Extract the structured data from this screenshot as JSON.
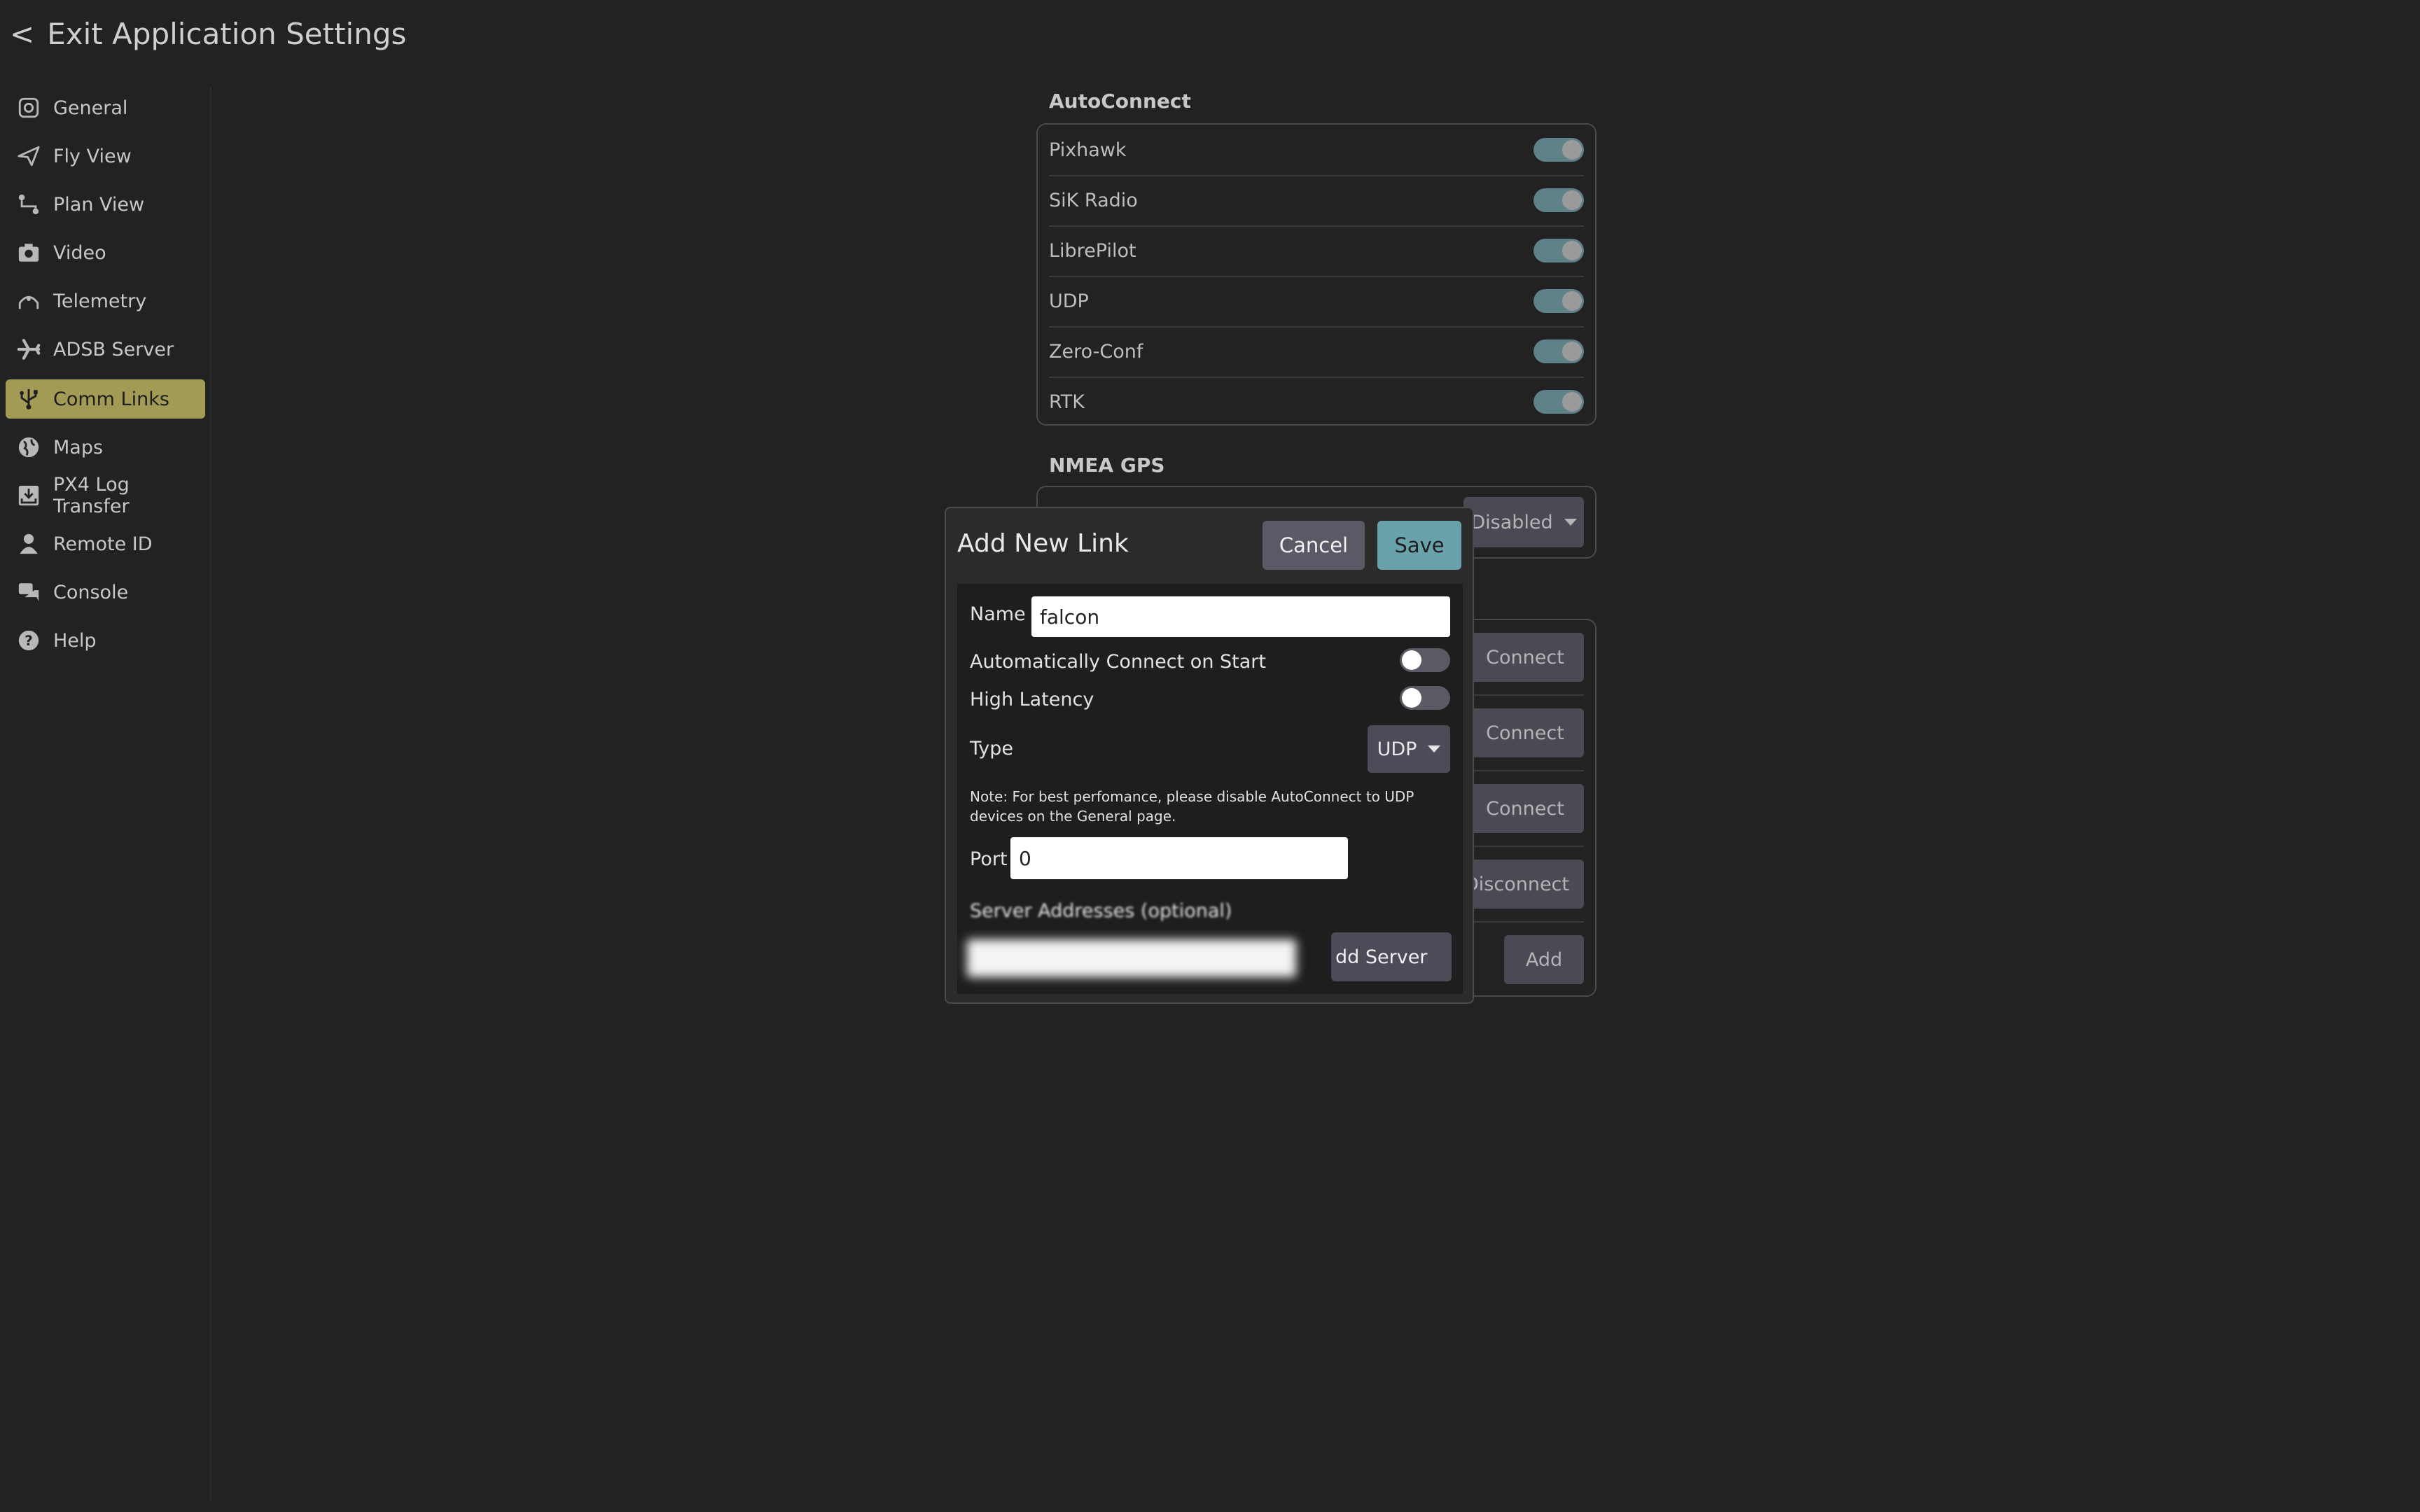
{
  "header": {
    "exit_label": "Exit Application Settings",
    "back_glyph": "<"
  },
  "sidebar": {
    "items": [
      {
        "label": "General",
        "icon": "general-icon"
      },
      {
        "label": "Fly View",
        "icon": "paper-plane-icon"
      },
      {
        "label": "Plan View",
        "icon": "route-icon"
      },
      {
        "label": "Video",
        "icon": "camera-icon"
      },
      {
        "label": "Telemetry",
        "icon": "telemetry-icon"
      },
      {
        "label": "ADSB Server",
        "icon": "airplane-icon"
      },
      {
        "label": "Comm Links",
        "icon": "usb-icon",
        "active": true
      },
      {
        "label": "Maps",
        "icon": "globe-icon"
      },
      {
        "label": "PX4 Log Transfer",
        "icon": "download-icon"
      },
      {
        "label": "Remote ID",
        "icon": "person-icon"
      },
      {
        "label": "Console",
        "icon": "chat-icon"
      },
      {
        "label": "Help",
        "icon": "help-icon"
      }
    ]
  },
  "autoconnect": {
    "title": "AutoConnect",
    "rows": [
      {
        "label": "Pixhawk",
        "on": true
      },
      {
        "label": "SiK Radio",
        "on": true
      },
      {
        "label": "LibrePilot",
        "on": true
      },
      {
        "label": "UDP",
        "on": true
      },
      {
        "label": "Zero-Conf",
        "on": true
      },
      {
        "label": "RTK",
        "on": true
      }
    ]
  },
  "nmea": {
    "title": "NMEA GPS",
    "value": "Disabled"
  },
  "links": {
    "buttons": [
      "Connect",
      "Connect",
      "Connect",
      "Disconnect"
    ],
    "add_label": "Add"
  },
  "dialog": {
    "title": "Add New Link",
    "cancel_label": "Cancel",
    "save_label": "Save",
    "name_label": "Name",
    "name_value": "falcon",
    "auto_connect_label": "Automatically Connect on Start",
    "auto_connect_on": false,
    "high_latency_label": "High Latency",
    "high_latency_on": false,
    "type_label": "Type",
    "type_value": "UDP",
    "note": "Note: For best perfomance, please disable AutoConnect to UDP devices on the General page.",
    "port_label": "Port",
    "port_value": "0",
    "server_addresses_label": "Server Addresses (optional)",
    "add_server_label": "dd Server"
  },
  "colors": {
    "background": "#222222",
    "active_sidebar": "#a39b55",
    "save_button": "#6aa2ab",
    "cancel_button": "#5a5a66",
    "toggle_on": "#5f8288"
  }
}
